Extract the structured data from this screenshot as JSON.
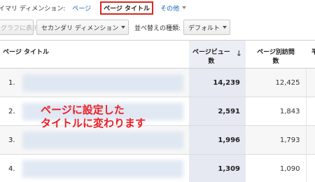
{
  "dimension_bar": {
    "primary_label": "イマリ ディメンション:",
    "option_page": "ページ",
    "option_page_title": "ページ タイトル",
    "option_other": "その他"
  },
  "toolbar": {
    "graph_button": "グラフに表示",
    "secondary_dimension": "セカンダリ ディメンション",
    "sort_label": "並べ替えの種類:",
    "sort_value": "デフォルト"
  },
  "table": {
    "headers": {
      "title": "ページ タイトル",
      "views_line1": "ページビュー",
      "views_line2": "数",
      "unique_line1": "ページ別訪問",
      "unique_line2": "数",
      "more": "平"
    },
    "rows": [
      {
        "index": "1.",
        "views": "14,239",
        "unique": "12,425"
      },
      {
        "index": "2.",
        "views": "2,591",
        "unique": "1,843"
      },
      {
        "index": "3.",
        "views": "1,996",
        "unique": "1,793"
      },
      {
        "index": "4.",
        "views": "1,309",
        "unique": "1,090"
      }
    ]
  },
  "annotation": "ページに設定した\nタイトルに変わります",
  "colors": {
    "accent_red": "#d9281c",
    "annotation_red": "#ee1c24",
    "link_blue": "#1a5fb4",
    "sorted_column_bg": "#e6e9f2"
  }
}
